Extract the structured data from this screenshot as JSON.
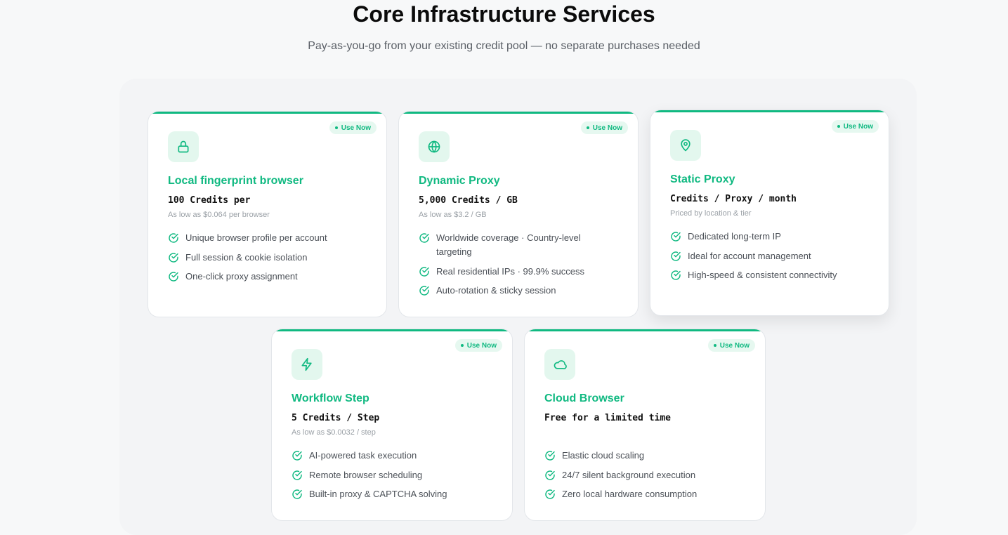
{
  "header": {
    "title": "Core Infrastructure Services",
    "subtitle": "Pay-as-you-go from your existing credit pool — no separate purchases needed"
  },
  "accent_color": "#10b981",
  "cards": [
    {
      "badge": "Use Now",
      "icon": "lock-icon",
      "title": "Local fingerprint browser",
      "price": "100 Credits per",
      "price_note": "As low as $0.064 per browser",
      "features": [
        "Unique browser profile per account",
        "Full session & cookie isolation",
        "One-click proxy assignment"
      ]
    },
    {
      "badge": "Use Now",
      "icon": "globe-icon",
      "title": "Dynamic Proxy",
      "price": "5,000 Credits / GB",
      "price_note": "As low as $3.2 / GB",
      "features": [
        "Worldwide coverage · Country-level targeting",
        "Real residential IPs · 99.9% success",
        "Auto-rotation & sticky session"
      ]
    },
    {
      "badge": "Use Now",
      "icon": "map-pin-icon",
      "title": "Static Proxy",
      "price": "Credits / Proxy / month",
      "price_note": "Priced by location & tier",
      "features": [
        "Dedicated long-term IP",
        "Ideal for account management",
        "High-speed & consistent connectivity"
      ]
    },
    {
      "badge": "Use Now",
      "icon": "lightning-icon",
      "title": "Workflow Step",
      "price": "5 Credits / Step",
      "price_note": "As low as $0.0032 / step",
      "features": [
        "AI-powered task execution",
        "Remote browser scheduling",
        "Built-in proxy & CAPTCHA solving"
      ]
    },
    {
      "badge": "Use Now",
      "icon": "cloud-icon",
      "title": "Cloud Browser",
      "price": "Free for a limited time",
      "price_note": "",
      "features": [
        "Elastic cloud scaling",
        "24/7 silent background execution",
        "Zero local hardware consumption"
      ]
    }
  ]
}
